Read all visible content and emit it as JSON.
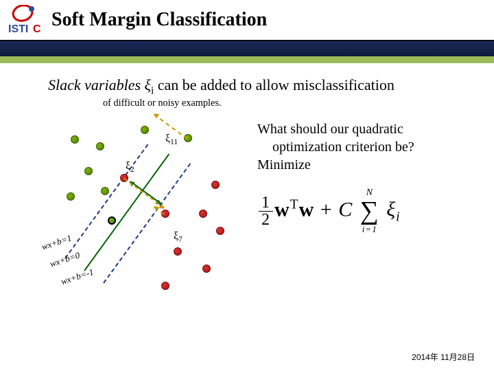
{
  "title": "Soft Margin Classification",
  "intro_line1": "Slack variables ξ",
  "intro_sub_i": "i",
  "intro_line1_rest": " can be added to allow misclassification",
  "intro_line2": "of difficult or noisy examples.",
  "question_l1": "What should our quadratic",
  "question_l2": "optimization criterion be?",
  "question_l3": "Minimize",
  "slack_labels": {
    "xi11": "ξ11",
    "xi2": "ξ2",
    "xi7": "ξ7"
  },
  "line_labels": {
    "wp1": "wx+b=1",
    "w0": "wx+b=0",
    "wm1": "wx+b=-1"
  },
  "formula": {
    "half_num": "1",
    "half_den": "2",
    "w": "w",
    "T": "T",
    "plus": " + ",
    "C": "C",
    "sum_top": "N",
    "sum_bot": "i=1",
    "xi": "ξ",
    "sub_i": "i"
  },
  "date": "2014年 11月28日",
  "colors": {
    "green_bar": "#9BBB59",
    "blue_bar": "#1a2a5a"
  }
}
